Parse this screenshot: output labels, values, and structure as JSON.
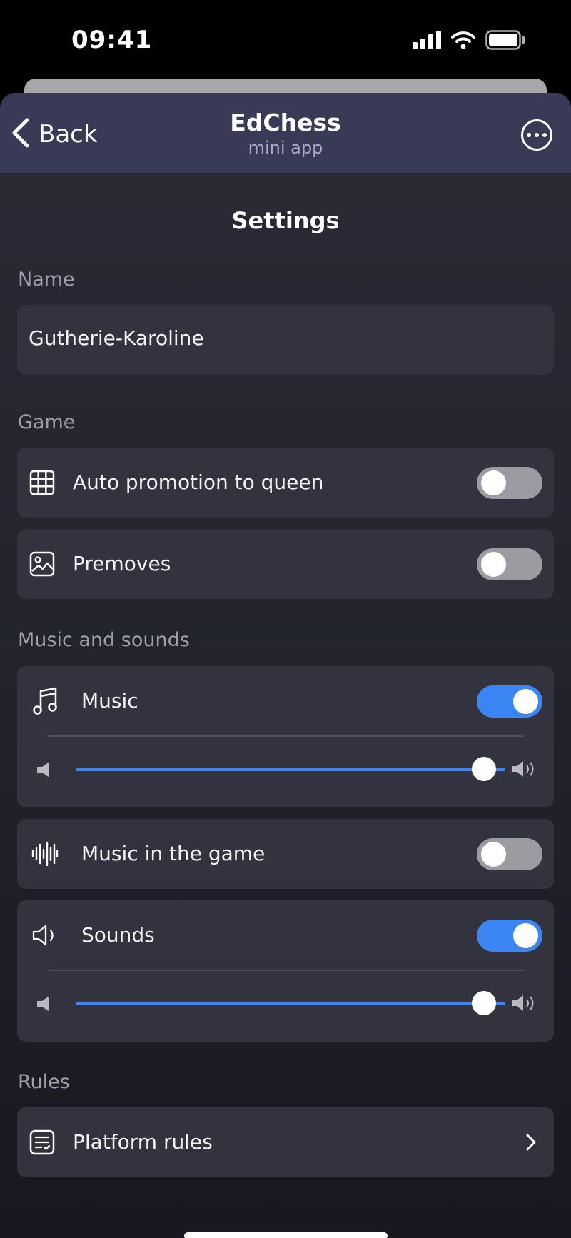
{
  "status_bar": {
    "time": "09:41"
  },
  "nav": {
    "back_label": "Back",
    "title": "EdChess",
    "subtitle": "mini app"
  },
  "page": {
    "title": "Settings"
  },
  "name_section": {
    "label": "Name",
    "value": "Gutherie-Karoline"
  },
  "game_section": {
    "label": "Game",
    "items": [
      {
        "label": "Auto promotion to queen",
        "icon": "grid-icon",
        "enabled": false
      },
      {
        "label": "Premoves",
        "icon": "image-icon",
        "enabled": false
      }
    ]
  },
  "music_section": {
    "label": "Music and sounds",
    "music": {
      "label": "Music",
      "icon": "music-note-icon",
      "enabled": true,
      "volume": 0.95
    },
    "music_in_game": {
      "label": "Music in the game",
      "icon": "waveform-icon",
      "enabled": false
    },
    "sounds": {
      "label": "Sounds",
      "icon": "speaker-icon",
      "enabled": true,
      "volume": 0.95
    }
  },
  "rules_section": {
    "label": "Rules",
    "items": [
      {
        "label": "Platform rules",
        "icon": "document-list-icon"
      }
    ]
  },
  "colors": {
    "accent": "#3b86f2",
    "nav_bg": "#393a56",
    "card_bg": "#32333e",
    "toggle_off": "#9b9ba1"
  }
}
